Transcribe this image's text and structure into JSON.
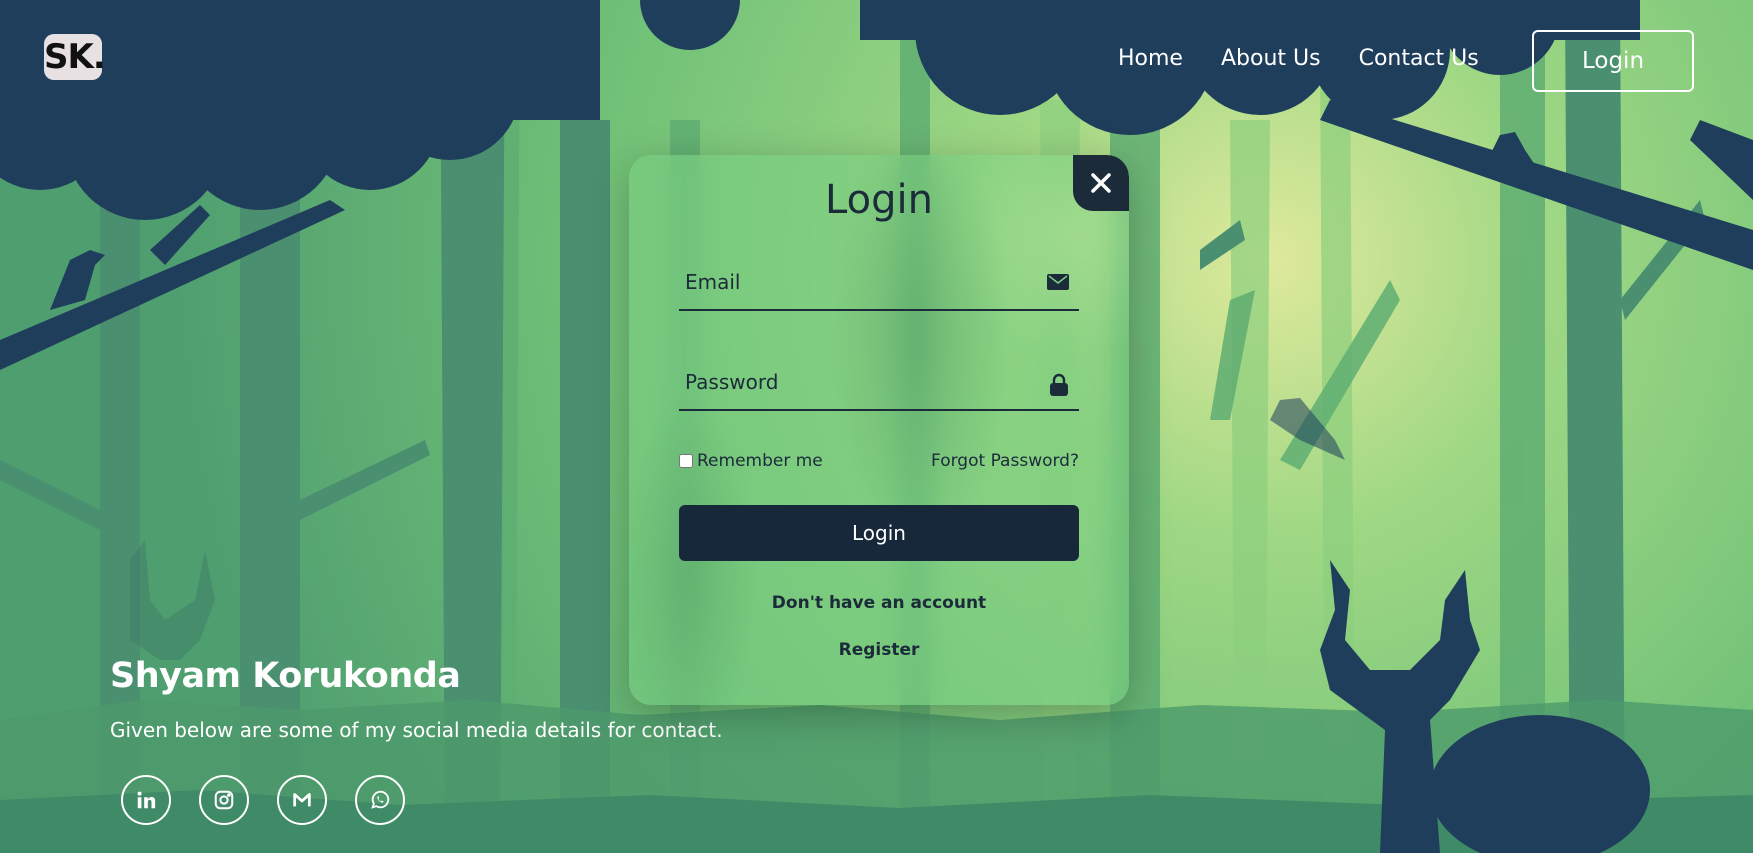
{
  "colors": {
    "sky_light": "#dce89a",
    "forest_light": "#8fd07a",
    "forest_mid": "#5aa36a",
    "forest_dark": "#3f8466",
    "silhouette": "#1f3e5c",
    "modal_dark": "#16283a",
    "text_dark": "#1c2b3a",
    "white": "#ffffff"
  },
  "header": {
    "logo": "SK.",
    "nav": [
      "Home",
      "About Us",
      "Contact Us"
    ],
    "login_button": "Login"
  },
  "hero": {
    "name": "Shyam Korukonda",
    "description": "Given below are some of my social media details for contact.",
    "socials": [
      "linkedin-icon",
      "instagram-icon",
      "gmail-icon",
      "whatsapp-icon"
    ]
  },
  "modal": {
    "title": "Login",
    "close_icon": "close-icon",
    "email_placeholder": "Email",
    "password_placeholder": "Password",
    "remember_label": "Remember me",
    "remember_checked": false,
    "forgot_label": "Forgot Password?",
    "submit_label": "Login",
    "no_account_text": "Don't have an account",
    "register_label": "Register"
  }
}
